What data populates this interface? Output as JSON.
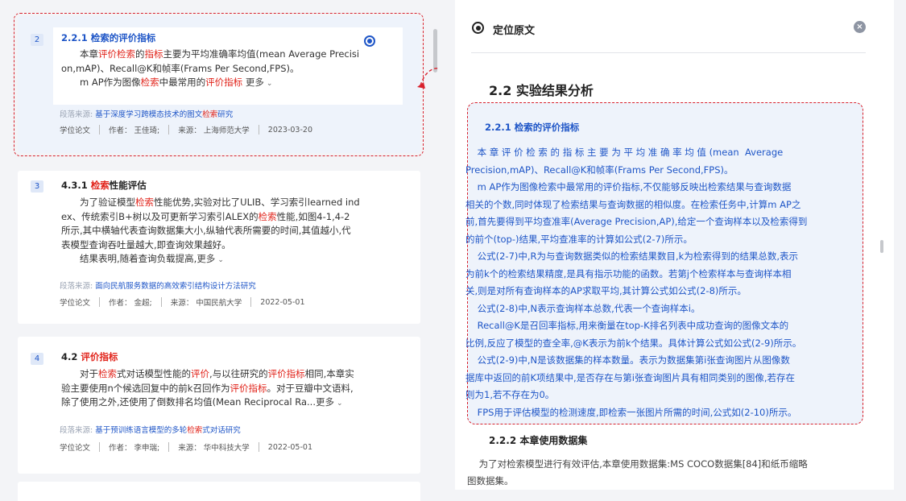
{
  "results": [
    {
      "index": "2",
      "title": "2.2.1 检索的评价指标",
      "body_lines": [
        [
          {
            "t": "本章"
          },
          {
            "t": "评价检索",
            "h": true
          },
          {
            "t": "的"
          },
          {
            "t": "指标",
            "h": true
          },
          {
            "t": "主要为平均准确率均值(mean Average Precisi"
          }
        ],
        [
          {
            "t": "on,mAP)、Recall@K和帧率(Frams Per Second,FPS)。"
          }
        ],
        [
          {
            "t": "m AP作为图像"
          },
          {
            "t": "检索",
            "h": true
          },
          {
            "t": "中最常用的"
          },
          {
            "t": "评价指标",
            "h": true
          },
          {
            "t": " "
          }
        ]
      ],
      "more_label": "更多",
      "source_label": "段落来源:",
      "source_parts": [
        {
          "t": "基于深度学习跨模态技术的图文"
        },
        {
          "t": "检索",
          "h": true
        },
        {
          "t": "研究"
        }
      ],
      "meta": [
        "学位论文",
        "作者：  王佳琦;",
        "来源：  上海师范大学",
        "2023-03-20"
      ]
    },
    {
      "index": "3",
      "title_parts": [
        {
          "t": "4.3.1 "
        },
        {
          "t": "检索",
          "h": true
        },
        {
          "t": "性能评估"
        }
      ],
      "body_lines": [
        [
          {
            "t": "为了验证模型"
          },
          {
            "t": "检索",
            "h": true
          },
          {
            "t": "性能优势,实验对比了ULIB、学习索引learned ind"
          }
        ],
        [
          {
            "t": "ex、传统索引B+树以及可更新学习索引ALEX的"
          },
          {
            "t": "检索",
            "h": true
          },
          {
            "t": "性能,如图4-1,4-2"
          }
        ],
        [
          {
            "t": "所示,其中横轴代表查询数据集大小,纵轴代表所需要的时间,其值越小,代"
          }
        ],
        [
          {
            "t": "表模型查询吞吐量越大,即查询效果越好。"
          }
        ],
        [
          {
            "t": "结果表明,随着查询负载提高,"
          }
        ]
      ],
      "more_label": "更多",
      "source_label": "段落来源:",
      "source_parts": [
        {
          "t": "面向民航服务数据的高效索引结构设计方法研究"
        }
      ],
      "meta": [
        "学位论文",
        "作者：  金超;",
        "来源：  中国民航大学",
        "2022-05-01"
      ]
    },
    {
      "index": "4",
      "title_parts": [
        {
          "t": "4.2 "
        },
        {
          "t": "评价指标",
          "h": true
        }
      ],
      "body_lines": [
        [
          {
            "t": "对于"
          },
          {
            "t": "检索",
            "h": true
          },
          {
            "t": "式对话模型性能的"
          },
          {
            "t": "评价",
            "h": true
          },
          {
            "t": ",与以往研究的"
          },
          {
            "t": "评价指标",
            "h": true
          },
          {
            "t": "相同,本章实"
          }
        ],
        [
          {
            "t": "验主要使用n个候选回复中的前k召回作为"
          },
          {
            "t": "评价指标",
            "h": true
          },
          {
            "t": "。对于豆瓣中文语料,"
          }
        ],
        [
          {
            "t": "除了使用之外,还使用了倒数排名均值(Mean Reciprocal Ra..."
          }
        ]
      ],
      "more_label": "更多",
      "source_label": "段落来源:",
      "source_parts": [
        {
          "t": "基于预训练语言模型的多轮"
        },
        {
          "t": "检索",
          "h": true
        },
        {
          "t": "式对话研究"
        }
      ],
      "meta": [
        "学位论文",
        "作者：  李申瑞;",
        "来源：  华中科技大学",
        "2022-05-01"
      ]
    }
  ],
  "reader": {
    "panel_title": "定位原文",
    "close_symbol": "×",
    "section_title": "2.2 实验结果分析",
    "cite_head": "2.2.1 检索的评价指标",
    "cite_lines": [
      "    本 章 评 价 检 索 的 指 标 主 要 为 平 均 准 确 率 均 值 (mean  Average",
      "Precision,mAP)、Recall@K和帧率(Frams Per Second,FPS)。",
      "    m AP作为图像检索中最常用的评价指标,不仅能够反映出检索结果与查询数据",
      "相关的个数,同时体现了检索结果与查询数据的相似度。在检索任务中,计算m AP之",
      "前,首先要得到平均查准率(Average Precision,AP),给定一个查询样本以及检索得到",
      "的前个(top-)结果,平均查准率的计算如公式(2-7)所示。",
      "    公式(2-7)中,R为与查询数据类似的检索结果数目,k为检索得到的结果总数,表示",
      "为前k个的检索结果精度,是具有指示功能的函数。若第j个检索样本与查询样本相",
      "关,则是对所有查询样本的AP求取平均,其计算公式如公式(2-8)所示。",
      "    公式(2-8)中,N表示查询样本总数,代表一个查询样本i。",
      "    Recall@K是召回率指标,用来衡量在top-K排名列表中成功查询的图像文本的",
      "比例,反应了模型的查全率,@K表示为前k个结果。具体计算公式如公式(2-9)所示。",
      "    公式(2-9)中,N是该数据集的样本数量。表示为数据集第i张查询图片从图像数",
      "据库中返回的前K项结果中,是否存在与第i张查询图片具有相同类别的图像,若存在",
      "则为1,若不存在为0。",
      "    FPS用于评估模型的检测速度,即检索一张图片所需的时间,公式如(2-10)所示。"
    ],
    "sub_title": "2.2.2 本章使用数据集",
    "body_lines": [
      "    为了对检索模型进行有效评估,本章使用数据集:MS COCO数据集[84]和纸币缩略",
      "图数据集。"
    ]
  },
  "colors": {
    "accent": "#1f56c7",
    "highlight": "#e1241b",
    "dashed_outline": "#d8212c"
  }
}
